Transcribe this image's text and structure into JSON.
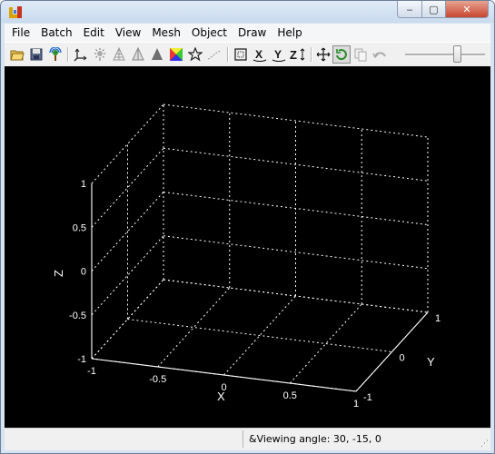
{
  "window": {
    "minimize_glyph": "‒",
    "maximize_glyph": "▢",
    "close_glyph": "✕"
  },
  "menu": [
    "File",
    "Batch",
    "Edit",
    "View",
    "Mesh",
    "Object",
    "Draw",
    "Help"
  ],
  "toolbar": {
    "icons": [
      "open-folder-icon",
      "save-disk-icon",
      "antenna-tree-icon",
      "axes-icon",
      "light-icon",
      "mesh-wireframe-icon",
      "mesh-surface-icon",
      "solid-shape-icon",
      "color-map-icon",
      "star-icon",
      "curve-icon",
      "bounding-box-icon",
      "rotate-x-icon",
      "rotate-y-icon",
      "rotate-z-icon",
      "move-arrows-icon",
      "rotate-view-icon",
      "copy-icon",
      "undo-icon"
    ],
    "slider_level": 0.65
  },
  "plot": {
    "z_ticks": [
      "1",
      "0.5",
      "0",
      "-0.5",
      "-1"
    ],
    "x_ticks": [
      "-1",
      "-0.5",
      "0",
      "0.5",
      "1"
    ],
    "y_ticks": [
      "-1",
      "0",
      "1"
    ],
    "x_label": "X",
    "y_label": "Y",
    "z_label": "Z",
    "background": "#000000",
    "grid_color": "#ffffff"
  },
  "status": {
    "viewing_angle": "&Viewing angle: 30, -15, 0"
  }
}
